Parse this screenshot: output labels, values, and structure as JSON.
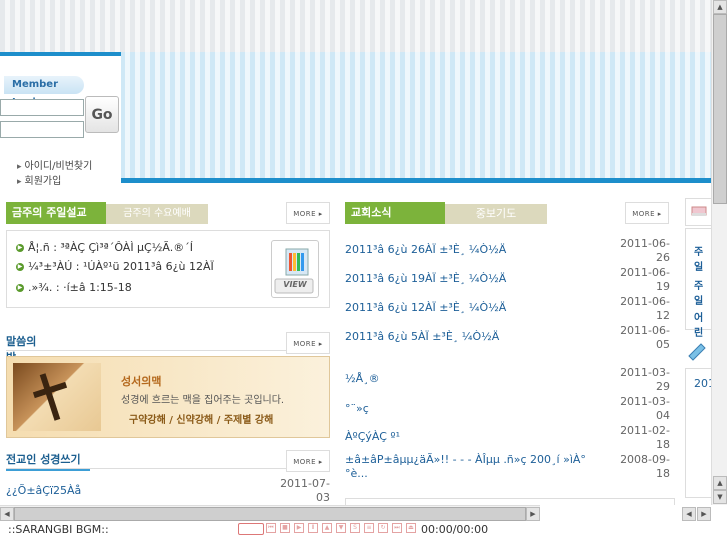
{
  "login": {
    "title": "Member Login",
    "go_label": "Go",
    "links": [
      "아이디/비번찾기",
      "회원가입"
    ]
  },
  "sermon": {
    "tab_active": "금주의 주일설교",
    "tab_inactive": "금주의 수요예배",
    "more": "MORE",
    "items": [
      "Å¦.ñ : ³ªÀÇ Çì³ª´ÔÀÌ µÇ½Ã.®´Í",
      "¼³±³ÀÚ : ¹ÚÀº¹ü 2011³â 6¿ù 12ÀÏ",
      ".»¾. : ·í±â 1:15-18"
    ],
    "view_label": "VIEW"
  },
  "word_room": {
    "title": "말씀의 방",
    "more": "MORE",
    "banner_title": "성서의맥",
    "banner_sub": "성경에 흐르는 맥을 집어주는 곳입니다.",
    "banner_links": "구약강해 / 신약강해 / 주제별 강해"
  },
  "evangelist": {
    "title": "전교인 성경쓰기",
    "more": "MORE",
    "items": [
      {
        "text": "¿¿Õ±âÇï25Àå",
        "date": "2011-07-03"
      }
    ]
  },
  "news": {
    "tab_active": "교회소식",
    "tab_inactive": "중보기도",
    "more": "MORE",
    "items": [
      {
        "text": "2011³â 6¿ù 26ÀÏ ±³È¸ ¼Ò½Ä",
        "date": "2011-06-26"
      },
      {
        "text": "2011³â 6¿ù 19ÀÏ ±³È¸ ¼Ò½Ä",
        "date": "2011-06-19"
      },
      {
        "text": "2011³â 6¿ù 12ÀÏ ±³È¸ ¼Ò½Ä",
        "date": "2011-06-12"
      },
      {
        "text": "2011³â 6¿ù 5ÀÏ ±³È¸ ¼Ò½Ä",
        "date": "2011-06-05"
      }
    ]
  },
  "prayer": {
    "items": [
      {
        "text": "½Å¸®",
        "date": "2011-03-29"
      },
      {
        "text": "°¨»ç",
        "date": "2011-03-04"
      },
      {
        "text": "ÀºÇýÀÇ º¹",
        "date": "2011-02-18"
      },
      {
        "text": "±â±âP±âµµ¿äÃ»!! - - - ÀÎµµ .ñ»ç 200¸í »ìÀ° °è...",
        "date": "2008-09-18"
      }
    ]
  },
  "right_col": {
    "items": [
      "주일",
      "주일",
      "어린"
    ],
    "partial": "201"
  },
  "player": {
    "label": "::SARANGBI BGM::",
    "time": "00:00/00:00"
  }
}
